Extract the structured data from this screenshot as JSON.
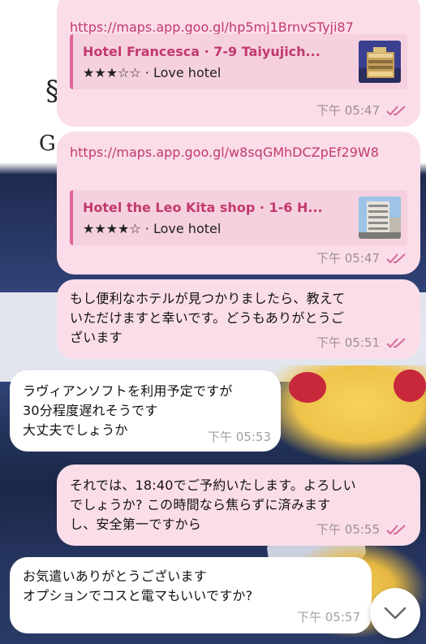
{
  "messages": [
    {
      "direction": "out",
      "link": "https://maps.app.goo.gl/hp5mj1BrnvSTyji87",
      "preview": {
        "title": "Hotel Francesca · 7-9 Taiyujich...",
        "subtitle": "★★★☆☆ · Love hotel",
        "thumb_icon": "hotel-photo"
      },
      "time": "下午 05:47",
      "read": true
    },
    {
      "direction": "out",
      "link": "https://maps.app.goo.gl/w8sqGMhDCZpEf29W8",
      "preview": {
        "title": "Hotel the Leo Kita shop · 1-6 H...",
        "subtitle": "★★★★☆ · Love hotel",
        "thumb_icon": "hotel-photo"
      },
      "time": "下午 05:47",
      "read": true
    },
    {
      "direction": "out",
      "text": "もし便利なホテルが見つかりましたら、教えて\nいただけますと幸いです。どうもありがとうご\nざいます",
      "time": "下午 05:51",
      "read": true
    },
    {
      "direction": "in",
      "text": "ラヴィアンソフトを利用予定ですが\n30分程度遅れそうです\n大丈夫でしょうか",
      "time": "下午 05:53"
    },
    {
      "direction": "out",
      "text": "それでは、18:40でご予約いたします。よろしい\nでしょうか? この時間なら焦らずに済みます\nし、安全第一ですから",
      "time": "下午 05:55",
      "read": true
    },
    {
      "direction": "in",
      "text": "お気遣いありがとうございます\nオプションでコスと電マもいいですか?",
      "time": "下午 05:57"
    }
  ],
  "scroll_button": {
    "icon": "chevron-down-icon"
  },
  "colors": {
    "outgoing_bubble": "#fbdde9",
    "incoming_bubble": "#ffffff",
    "link": "#c23a6c",
    "preview_bg": "#f5d0de",
    "read_ticks": "#d56a98"
  }
}
